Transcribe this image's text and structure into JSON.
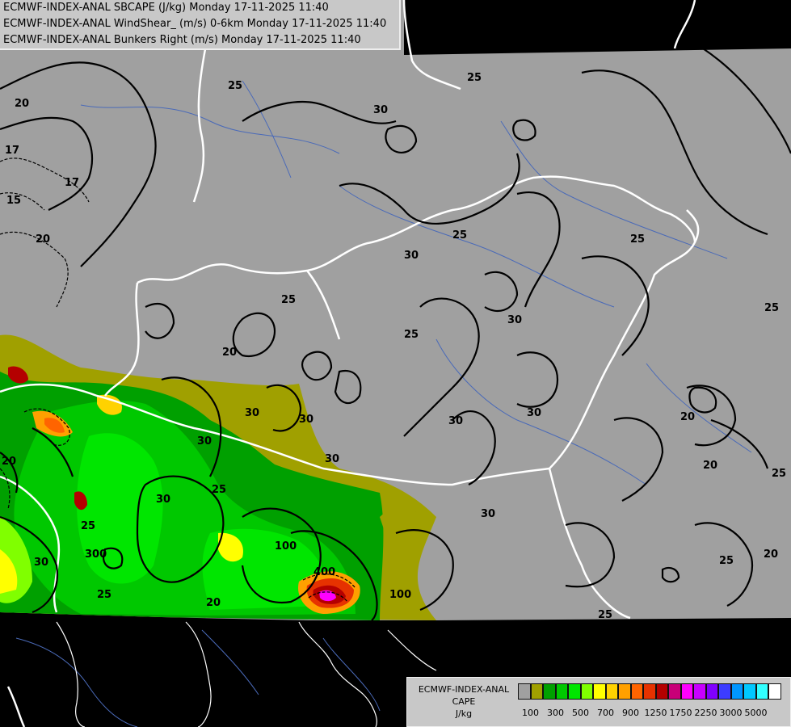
{
  "title_lines": [
    "ECMWF-INDEX-ANAL SBCAPE (J/kg) Monday 17-11-2025 11:40",
    "ECMWF-INDEX-ANAL WindShear_ (m/s) 0-6km Monday 17-11-2025 11:40",
    "ECMWF-INDEX-ANAL Bunkers Right (m/s) Monday 17-11-2025 11:40"
  ],
  "legend": {
    "title_line1": "ECMWF-INDEX-ANAL",
    "title_line2": "CAPE",
    "title_line3": "J/kg",
    "colors": [
      "#a0a0a0",
      "#a0a000",
      "#00a000",
      "#00c800",
      "#00e600",
      "#80ff00",
      "#ffff00",
      "#ffd200",
      "#ffa000",
      "#ff6400",
      "#e63200",
      "#b40000",
      "#c80078",
      "#ff00ff",
      "#c800ff",
      "#8000ff",
      "#3c3cff",
      "#0096ff",
      "#00c8ff",
      "#32ffff",
      "#ffffff"
    ],
    "tick_labels": [
      "100",
      "300",
      "500",
      "700",
      "900",
      "1250",
      "1750",
      "2250",
      "3000",
      "5000"
    ]
  },
  "contour_labels": [
    "25",
    "20",
    "17",
    "30",
    "15",
    "20",
    "17",
    "25",
    "30",
    "25",
    "25",
    "30",
    "25",
    "30",
    "20",
    "20",
    "25",
    "20",
    "30",
    "30",
    "30",
    "25",
    "30",
    "25",
    "20",
    "25",
    "30",
    "25",
    "100",
    "400",
    "100",
    "20",
    "25",
    "30",
    "30",
    "25",
    "20",
    "300",
    "25",
    "30"
  ],
  "colors": {
    "background": "#000000",
    "data_area": "#a0a0a0",
    "borders": "#ffffff",
    "rivers": "#5a78c8",
    "contours": "#000000"
  }
}
